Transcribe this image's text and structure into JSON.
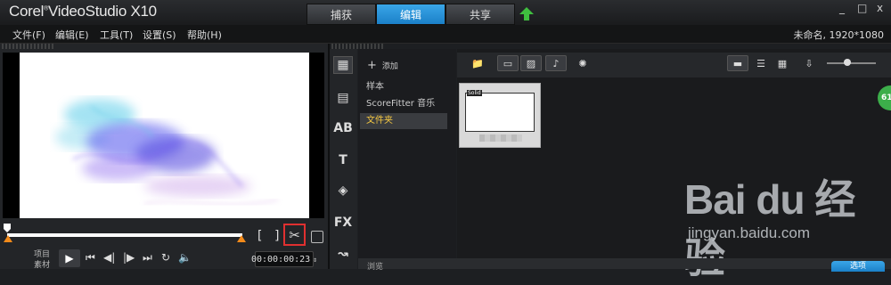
{
  "app": {
    "title": "Corel VideoStudio X10",
    "window_controls": [
      "_",
      "□",
      "x"
    ]
  },
  "tabs": [
    {
      "label": "捕获",
      "active": false
    },
    {
      "label": "编辑",
      "active": true
    },
    {
      "label": "共享",
      "active": false
    }
  ],
  "menu": {
    "items": [
      "文件(F)",
      "编辑(E)",
      "工具(T)",
      "设置(S)",
      "帮助(H)"
    ],
    "project_info": "未命名, 1920*1080"
  },
  "player": {
    "mode_labels": [
      "项目",
      "素材"
    ],
    "mark_in": "[",
    "mark_out": "]",
    "timecode": "00:00:00:23",
    "controls": [
      "play",
      "home",
      "prev-frame",
      "next-frame",
      "end",
      "repeat",
      "volume"
    ]
  },
  "library": {
    "add_label": "添加",
    "items": [
      {
        "label": "样本",
        "selected": false
      },
      {
        "label": "ScoreFitter 音乐",
        "selected": false
      },
      {
        "label": "文件夹",
        "selected": true
      }
    ],
    "bottom_label": "浏览",
    "category_icons": [
      "media-icon",
      "instant-project-icon",
      "transition-icon",
      "title-icon",
      "graphic-icon",
      "filter-fx-icon",
      "path-icon"
    ]
  },
  "content": {
    "thumbnail_tag": "Solid",
    "badge": "61",
    "options_label": "选项"
  },
  "watermark": {
    "main": "Bai du 经验",
    "url": "jingyan.baidu.com"
  },
  "colors": {
    "accent_blue": "#1b80c8",
    "highlight_red": "#e03030",
    "handle_orange": "#f28a1a",
    "selected_yellow": "#f5c842",
    "badge_green": "#3cae4a"
  }
}
